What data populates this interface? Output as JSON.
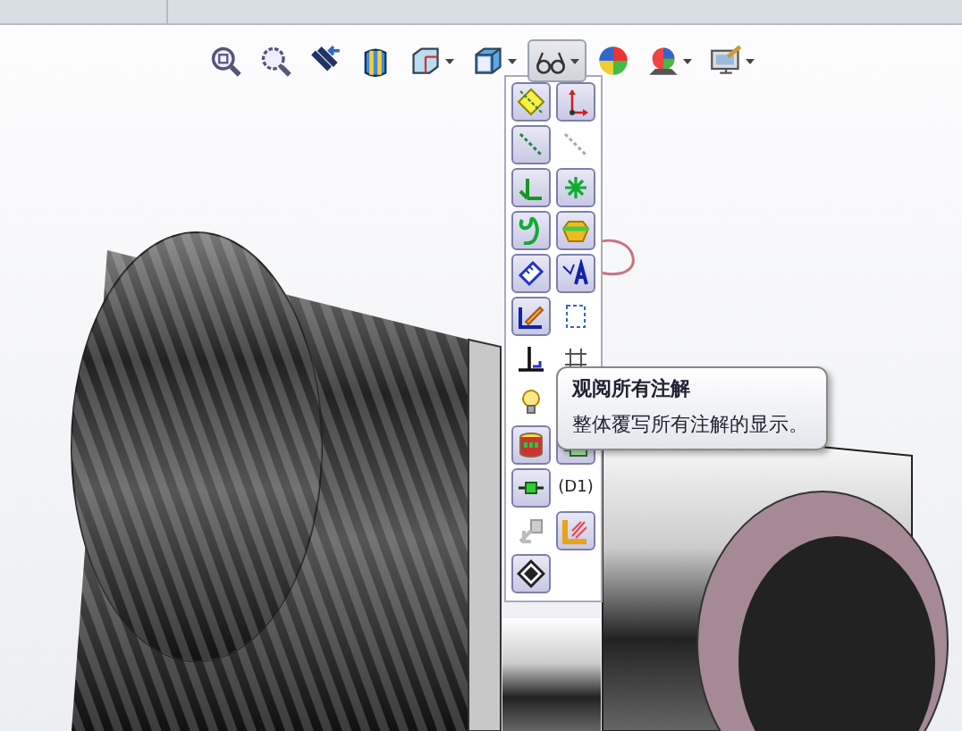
{
  "toolbar": {
    "buttons": [
      {
        "dropdown": false,
        "selected": false
      },
      {
        "dropdown": false,
        "selected": false
      },
      {
        "dropdown": false,
        "selected": false
      },
      {
        "dropdown": false,
        "selected": false
      },
      {
        "dropdown": true,
        "selected": false
      },
      {
        "dropdown": true,
        "selected": false
      },
      {
        "dropdown": true,
        "selected": true
      },
      {
        "dropdown": false,
        "selected": false
      },
      {
        "dropdown": true,
        "selected": false
      },
      {
        "dropdown": true,
        "selected": false
      }
    ]
  },
  "visibility_menu": {
    "items": [
      {
        "selected": true
      },
      {
        "selected": true
      },
      {
        "selected": true
      },
      {
        "selected": false
      },
      {
        "selected": true
      },
      {
        "selected": true
      },
      {
        "selected": true
      },
      {
        "selected": true
      },
      {
        "selected": true
      },
      {
        "selected": true
      },
      {
        "selected": true
      },
      {
        "selected": false
      },
      {
        "selected": false
      },
      {
        "selected": false
      },
      {
        "selected": false
      },
      {
        "selected": true
      },
      {
        "selected": true
      },
      {
        "selected": true
      },
      {
        "selected": false,
        "label": "(D1)"
      },
      {
        "selected": false
      },
      {
        "selected": true
      },
      {
        "selected": true
      }
    ]
  },
  "tooltip": {
    "title": "观阅所有注解",
    "description": "整体覆写所有注解的显示。"
  }
}
